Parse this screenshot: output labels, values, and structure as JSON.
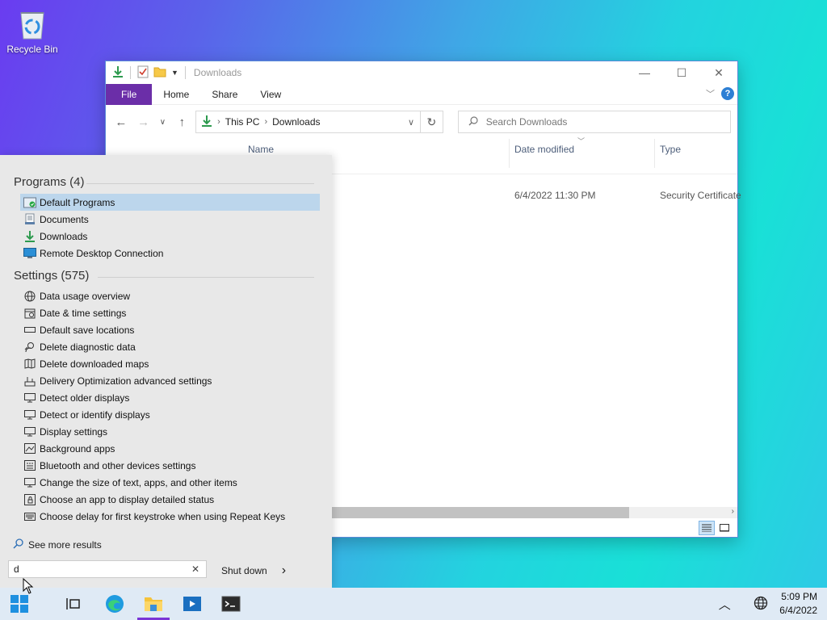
{
  "desktop": {
    "recycle_bin_label": "Recycle Bin"
  },
  "explorer": {
    "title": "Downloads",
    "ribbon_tabs": [
      "File",
      "Home",
      "Share",
      "View"
    ],
    "help_label": "?",
    "address": {
      "root": "This PC",
      "current": "Downloads"
    },
    "search_placeholder": "Search Downloads",
    "columns": {
      "name": "Name",
      "date_modified": "Date modified",
      "type": "Type"
    },
    "rows": [
      {
        "date_modified": "6/4/2022 11:30 PM",
        "type": "Security Certificate"
      }
    ]
  },
  "start_search": {
    "programs_header": "Programs (4)",
    "programs": [
      {
        "label": "Default Programs",
        "icon": "default-programs-icon",
        "selected": true
      },
      {
        "label": "Documents",
        "icon": "documents-icon"
      },
      {
        "label": "Downloads",
        "icon": "downloads-icon"
      },
      {
        "label": "Remote Desktop Connection",
        "icon": "remote-desktop-icon"
      }
    ],
    "settings_header": "Settings (575)",
    "settings": [
      {
        "label": "Data usage overview",
        "icon": "globe-icon"
      },
      {
        "label": "Date & time settings",
        "icon": "calendar-icon"
      },
      {
        "label": "Default save locations",
        "icon": "drive-icon"
      },
      {
        "label": "Delete diagnostic data",
        "icon": "person-search-icon"
      },
      {
        "label": "Delete downloaded maps",
        "icon": "map-icon"
      },
      {
        "label": "Delivery Optimization advanced settings",
        "icon": "delivery-icon"
      },
      {
        "label": "Detect older displays",
        "icon": "monitor-icon"
      },
      {
        "label": "Detect or identify displays",
        "icon": "monitor-icon"
      },
      {
        "label": "Display settings",
        "icon": "monitor-icon"
      },
      {
        "label": "Background apps",
        "icon": "background-apps-icon"
      },
      {
        "label": "Bluetooth and other devices settings",
        "icon": "keyboard-devices-icon"
      },
      {
        "label": "Change the size of text, apps, and other items",
        "icon": "monitor-icon"
      },
      {
        "label": "Choose an app to display detailed status",
        "icon": "lock-icon"
      },
      {
        "label": "Choose delay for first keystroke when using Repeat Keys",
        "icon": "keyboard-icon"
      }
    ],
    "see_more": "See more results",
    "query": "d",
    "clear_label": "✕",
    "shutdown_label": "Shut down"
  },
  "taskbar": {
    "time": "5:09 PM",
    "date": "6/4/2022"
  }
}
